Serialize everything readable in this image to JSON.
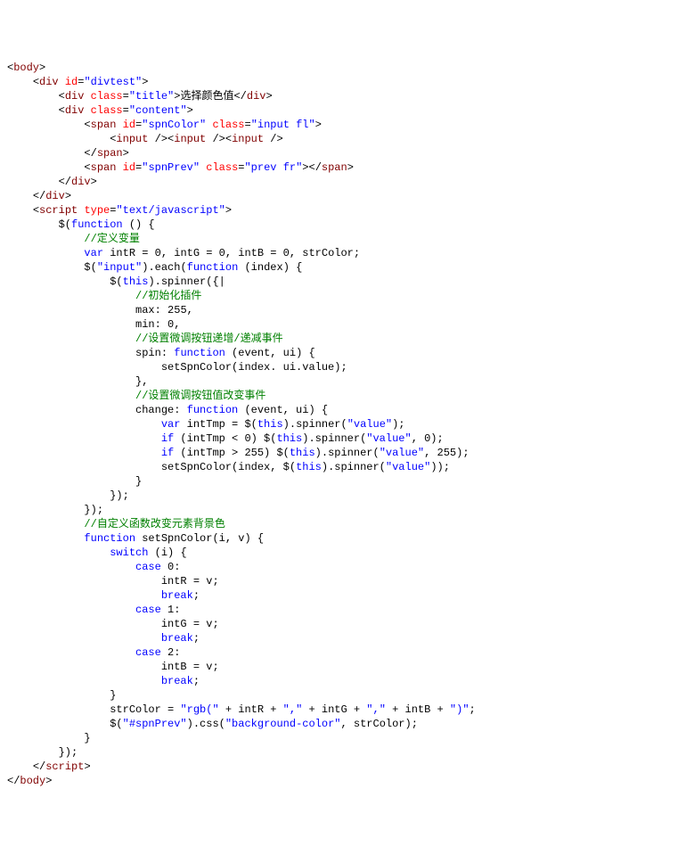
{
  "lines": [
    [
      [
        "<",
        "t-punc"
      ],
      [
        "body",
        "t-tag"
      ],
      [
        ">",
        "t-punc"
      ]
    ],
    [
      [
        "    ",
        ""
      ],
      [
        "<",
        "t-punc"
      ],
      [
        "div",
        "t-tag"
      ],
      [
        " ",
        ""
      ],
      [
        "id",
        "t-attr"
      ],
      [
        "=",
        "t-punc"
      ],
      [
        "\"divtest\"",
        "t-str"
      ],
      [
        ">",
        "t-punc"
      ]
    ],
    [
      [
        "        ",
        ""
      ],
      [
        "<",
        "t-punc"
      ],
      [
        "div",
        "t-tag"
      ],
      [
        " ",
        ""
      ],
      [
        "class",
        "t-attr"
      ],
      [
        "=",
        "t-punc"
      ],
      [
        "\"title\"",
        "t-str"
      ],
      [
        ">",
        "t-punc"
      ],
      [
        "选择颜色值",
        "t-id"
      ],
      [
        "</",
        "t-punc"
      ],
      [
        "div",
        "t-tag"
      ],
      [
        ">",
        "t-punc"
      ]
    ],
    [
      [
        "        ",
        ""
      ],
      [
        "<",
        "t-punc"
      ],
      [
        "div",
        "t-tag"
      ],
      [
        " ",
        ""
      ],
      [
        "class",
        "t-attr"
      ],
      [
        "=",
        "t-punc"
      ],
      [
        "\"content\"",
        "t-str"
      ],
      [
        ">",
        "t-punc"
      ]
    ],
    [
      [
        "            ",
        ""
      ],
      [
        "<",
        "t-punc"
      ],
      [
        "span",
        "t-tag"
      ],
      [
        " ",
        ""
      ],
      [
        "id",
        "t-attr"
      ],
      [
        "=",
        "t-punc"
      ],
      [
        "\"spnColor\"",
        "t-str"
      ],
      [
        " ",
        ""
      ],
      [
        "class",
        "t-attr"
      ],
      [
        "=",
        "t-punc"
      ],
      [
        "\"input fl\"",
        "t-str"
      ],
      [
        ">",
        "t-punc"
      ]
    ],
    [
      [
        "                ",
        ""
      ],
      [
        "<",
        "t-punc"
      ],
      [
        "input",
        "t-tag"
      ],
      [
        " />",
        "t-punc"
      ],
      [
        "<",
        "t-punc"
      ],
      [
        "input",
        "t-tag"
      ],
      [
        " />",
        "t-punc"
      ],
      [
        "<",
        "t-punc"
      ],
      [
        "input",
        "t-tag"
      ],
      [
        " />",
        "t-punc"
      ]
    ],
    [
      [
        "            ",
        ""
      ],
      [
        "</",
        "t-punc"
      ],
      [
        "span",
        "t-tag"
      ],
      [
        ">",
        "t-punc"
      ]
    ],
    [
      [
        "            ",
        ""
      ],
      [
        "<",
        "t-punc"
      ],
      [
        "span",
        "t-tag"
      ],
      [
        " ",
        ""
      ],
      [
        "id",
        "t-attr"
      ],
      [
        "=",
        "t-punc"
      ],
      [
        "\"spnPrev\"",
        "t-str"
      ],
      [
        " ",
        ""
      ],
      [
        "class",
        "t-attr"
      ],
      [
        "=",
        "t-punc"
      ],
      [
        "\"prev fr\"",
        "t-str"
      ],
      [
        ">",
        "t-punc"
      ],
      [
        "</",
        "t-punc"
      ],
      [
        "span",
        "t-tag"
      ],
      [
        ">",
        "t-punc"
      ]
    ],
    [
      [
        "        ",
        ""
      ],
      [
        "</",
        "t-punc"
      ],
      [
        "div",
        "t-tag"
      ],
      [
        ">",
        "t-punc"
      ]
    ],
    [
      [
        "    ",
        ""
      ],
      [
        "</",
        "t-punc"
      ],
      [
        "div",
        "t-tag"
      ],
      [
        ">",
        "t-punc"
      ]
    ],
    [
      [
        "    ",
        ""
      ],
      [
        "<",
        "t-punc"
      ],
      [
        "script",
        "t-tag"
      ],
      [
        " ",
        ""
      ],
      [
        "type",
        "t-attr"
      ],
      [
        "=",
        "t-punc"
      ],
      [
        "\"text/javascript\"",
        "t-str"
      ],
      [
        ">",
        "t-punc"
      ]
    ],
    [
      [
        "        ",
        ""
      ],
      [
        "$(",
        "t-id"
      ],
      [
        "function",
        "t-kw"
      ],
      [
        " () {",
        "t-id"
      ]
    ],
    [
      [
        "            ",
        ""
      ],
      [
        "//定义变量",
        "t-cmt"
      ]
    ],
    [
      [
        "            ",
        ""
      ],
      [
        "var",
        "t-kw"
      ],
      [
        " intR = 0, intG = 0, intB = 0, strColor;",
        "t-id"
      ]
    ],
    [
      [
        "            ",
        ""
      ],
      [
        "$(",
        "t-id"
      ],
      [
        "\"input\"",
        "t-str"
      ],
      [
        ").each(",
        "t-id"
      ],
      [
        "function",
        "t-kw"
      ],
      [
        " (index) {",
        "t-id"
      ]
    ],
    [
      [
        "                ",
        ""
      ],
      [
        "$(",
        "t-id"
      ],
      [
        "this",
        "t-kw"
      ],
      [
        ").spinner({|",
        "t-id"
      ]
    ],
    [
      [
        "                    ",
        ""
      ],
      [
        "//初始化插件",
        "t-cmt"
      ]
    ],
    [
      [
        "                    ",
        ""
      ],
      [
        "max: 255,",
        "t-id"
      ]
    ],
    [
      [
        "                    ",
        ""
      ],
      [
        "min: 0,",
        "t-id"
      ]
    ],
    [
      [
        "                    ",
        ""
      ],
      [
        "//设置微调按钮递增/递减事件",
        "t-cmt"
      ]
    ],
    [
      [
        "                    ",
        ""
      ],
      [
        "spin: ",
        "t-id"
      ],
      [
        "function",
        "t-kw"
      ],
      [
        " (event, ui) {",
        "t-id"
      ]
    ],
    [
      [
        "                        ",
        ""
      ],
      [
        "setSpnColor(index. ui.value);",
        "t-id"
      ]
    ],
    [
      [
        "                    ",
        ""
      ],
      [
        "},",
        "t-id"
      ]
    ],
    [
      [
        "                    ",
        ""
      ],
      [
        "//设置微调按钮值改变事件",
        "t-cmt"
      ]
    ],
    [
      [
        "                    ",
        ""
      ],
      [
        "change: ",
        "t-id"
      ],
      [
        "function",
        "t-kw"
      ],
      [
        " (event, ui) {",
        "t-id"
      ]
    ],
    [
      [
        "                        ",
        ""
      ],
      [
        "var",
        "t-kw"
      ],
      [
        " intTmp = $(",
        "t-id"
      ],
      [
        "this",
        "t-kw"
      ],
      [
        ").spinner(",
        "t-id"
      ],
      [
        "\"value\"",
        "t-str"
      ],
      [
        ");",
        "t-id"
      ]
    ],
    [
      [
        "                        ",
        ""
      ],
      [
        "if",
        "t-kw"
      ],
      [
        " (intTmp < 0) $(",
        "t-id"
      ],
      [
        "this",
        "t-kw"
      ],
      [
        ").spinner(",
        "t-id"
      ],
      [
        "\"value\"",
        "t-str"
      ],
      [
        ", 0);",
        "t-id"
      ]
    ],
    [
      [
        "                        ",
        ""
      ],
      [
        "if",
        "t-kw"
      ],
      [
        " (intTmp > 255) $(",
        "t-id"
      ],
      [
        "this",
        "t-kw"
      ],
      [
        ").spinner(",
        "t-id"
      ],
      [
        "\"value\"",
        "t-str"
      ],
      [
        ", 255);",
        "t-id"
      ]
    ],
    [
      [
        "                        ",
        ""
      ],
      [
        "setSpnColor(index, $(",
        "t-id"
      ],
      [
        "this",
        "t-kw"
      ],
      [
        ").spinner(",
        "t-id"
      ],
      [
        "\"value\"",
        "t-str"
      ],
      [
        "));",
        "t-id"
      ]
    ],
    [
      [
        "                    ",
        ""
      ],
      [
        "}",
        "t-id"
      ]
    ],
    [
      [
        "                ",
        ""
      ],
      [
        "});",
        "t-id"
      ]
    ],
    [
      [
        "            ",
        ""
      ],
      [
        "});",
        "t-id"
      ]
    ],
    [
      [
        "            ",
        ""
      ],
      [
        "//自定义函数改变元素背景色",
        "t-cmt"
      ]
    ],
    [
      [
        "            ",
        ""
      ],
      [
        "function",
        "t-kw"
      ],
      [
        " setSpnColor(i, v) {",
        "t-id"
      ]
    ],
    [
      [
        "                ",
        ""
      ],
      [
        "switch",
        "t-kw"
      ],
      [
        " (i) {",
        "t-id"
      ]
    ],
    [
      [
        "                    ",
        ""
      ],
      [
        "case",
        "t-kw"
      ],
      [
        " 0:",
        "t-id"
      ]
    ],
    [
      [
        "                        ",
        ""
      ],
      [
        "intR = v;",
        "t-id"
      ]
    ],
    [
      [
        "                        ",
        ""
      ],
      [
        "break",
        "t-kw"
      ],
      [
        ";",
        "t-id"
      ]
    ],
    [
      [
        "                    ",
        ""
      ],
      [
        "case",
        "t-kw"
      ],
      [
        " 1:",
        "t-id"
      ]
    ],
    [
      [
        "                        ",
        ""
      ],
      [
        "intG = v;",
        "t-id"
      ]
    ],
    [
      [
        "                        ",
        ""
      ],
      [
        "break",
        "t-kw"
      ],
      [
        ";",
        "t-id"
      ]
    ],
    [
      [
        "                    ",
        ""
      ],
      [
        "case",
        "t-kw"
      ],
      [
        " 2:",
        "t-id"
      ]
    ],
    [
      [
        "                        ",
        ""
      ],
      [
        "intB = v;",
        "t-id"
      ]
    ],
    [
      [
        "                        ",
        ""
      ],
      [
        "break",
        "t-kw"
      ],
      [
        ";",
        "t-id"
      ]
    ],
    [
      [
        "                ",
        ""
      ],
      [
        "}",
        "t-id"
      ]
    ],
    [
      [
        "                ",
        ""
      ],
      [
        "strColor = ",
        "t-id"
      ],
      [
        "\"rgb(\"",
        "t-str"
      ],
      [
        " + intR + ",
        "t-id"
      ],
      [
        "\",\"",
        "t-str"
      ],
      [
        " + intG + ",
        "t-id"
      ],
      [
        "\",\"",
        "t-str"
      ],
      [
        " + intB + ",
        "t-id"
      ],
      [
        "\")\"",
        "t-str"
      ],
      [
        ";",
        "t-id"
      ]
    ],
    [
      [
        "                ",
        ""
      ],
      [
        "$(",
        "t-id"
      ],
      [
        "\"#spnPrev\"",
        "t-str"
      ],
      [
        ").css(",
        "t-id"
      ],
      [
        "\"background-color\"",
        "t-str"
      ],
      [
        ", strColor);",
        "t-id"
      ]
    ],
    [
      [
        "            ",
        ""
      ],
      [
        "}",
        "t-id"
      ]
    ],
    [
      [
        "        ",
        ""
      ],
      [
        "});",
        "t-id"
      ]
    ],
    [
      [
        "    ",
        ""
      ],
      [
        "</",
        "t-punc"
      ],
      [
        "script",
        "t-tag"
      ],
      [
        ">",
        "t-punc"
      ]
    ],
    [
      [
        "</",
        "t-punc"
      ],
      [
        "body",
        "t-tag"
      ],
      [
        ">",
        "t-punc"
      ]
    ]
  ]
}
